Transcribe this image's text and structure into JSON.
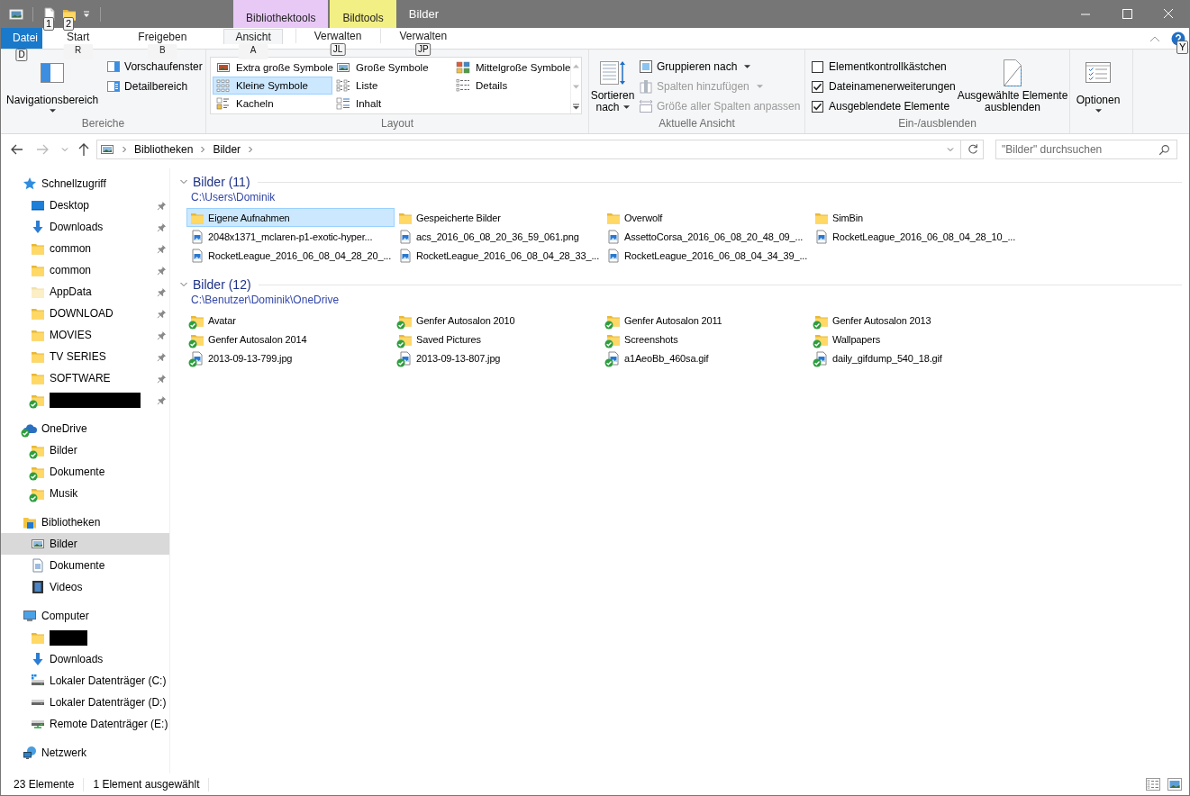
{
  "window": {
    "title": "Bilder",
    "quick_access_keytips": [
      "1",
      "2"
    ]
  },
  "context_tabs": [
    {
      "label": "Bibliothektools",
      "color": "#e8c9f6"
    },
    {
      "label": "Bildtools",
      "color": "#f2ef84"
    }
  ],
  "ribbon_tabs": [
    {
      "label": "Datei",
      "kind": "file",
      "keytip": "D",
      "selected": false
    },
    {
      "label": "Start",
      "kind": "tab",
      "keytip": "R",
      "selected": false
    },
    {
      "label": "Freigeben",
      "kind": "tab",
      "keytip": "B",
      "selected": false
    },
    {
      "label": "Ansicht",
      "kind": "tab",
      "keytip": "A",
      "selected": true
    },
    {
      "label": "Verwalten",
      "kind": "context",
      "keytip": "JL",
      "selected": false
    },
    {
      "label": "Verwalten",
      "kind": "context",
      "keytip": "JP",
      "selected": false
    }
  ],
  "help_keytip": "Y",
  "ribbon": {
    "panes": {
      "label": "Bereiche",
      "navigation_pane": "Navigationsbereich",
      "preview_pane": "Vorschaufenster",
      "details_pane": "Detailbereich"
    },
    "layout": {
      "label": "Layout",
      "options": [
        {
          "label": "Extra große Symbole",
          "kind": "xl",
          "selected": false
        },
        {
          "label": "Große Symbole",
          "kind": "large",
          "selected": false
        },
        {
          "label": "Mittelgroße Symbole",
          "kind": "medium",
          "selected": false
        },
        {
          "label": "Kleine Symbole",
          "kind": "small",
          "selected": true
        },
        {
          "label": "Liste",
          "kind": "list",
          "selected": false
        },
        {
          "label": "Details",
          "kind": "details",
          "selected": false
        },
        {
          "label": "Kacheln",
          "kind": "tiles",
          "selected": false
        },
        {
          "label": "Inhalt",
          "kind": "content",
          "selected": false
        }
      ]
    },
    "current_view": {
      "label": "Aktuelle Ansicht",
      "sort": "Sortieren nach",
      "commands": [
        {
          "label": "Gruppieren nach",
          "kind": "group",
          "dropdown": true,
          "disabled": false
        },
        {
          "label": "Spalten hinzufügen",
          "kind": "columns",
          "dropdown": true,
          "disabled": true
        },
        {
          "label": "Größe aller Spalten anpassen",
          "kind": "fit",
          "dropdown": false,
          "disabled": true
        }
      ]
    },
    "show_hide": {
      "label": "Ein-/ausblenden",
      "checkboxes": [
        {
          "label": "Elementkontrollkästchen",
          "checked": false
        },
        {
          "label": "Dateinamenerweiterungen",
          "checked": true
        },
        {
          "label": "Ausgeblendete Elemente",
          "checked": true
        }
      ],
      "hide_selected": "Ausgewählte Elemente ausblenden"
    },
    "options": {
      "label": "Optionen"
    }
  },
  "address": {
    "crumbs": [
      "Bibliotheken",
      "Bilder"
    ]
  },
  "search": {
    "placeholder": "\"Bilder\" durchsuchen"
  },
  "navigation": [
    {
      "label": "Schnellzugriff",
      "kind": "star",
      "synced": false,
      "children": [
        {
          "label": "Desktop",
          "kind": "desktop",
          "pinned": true,
          "synced": false,
          "selected": false
        },
        {
          "label": "Downloads",
          "kind": "download",
          "pinned": true,
          "synced": false,
          "selected": false
        },
        {
          "label": "common",
          "kind": "folder",
          "pinned": true,
          "synced": false,
          "selected": false
        },
        {
          "label": "common",
          "kind": "folder",
          "pinned": true,
          "synced": false,
          "selected": false
        },
        {
          "label": "AppData",
          "kind": "folder-hidden",
          "pinned": true,
          "synced": false,
          "selected": false
        },
        {
          "label": "DOWNLOAD",
          "kind": "folder",
          "pinned": true,
          "synced": false,
          "selected": false
        },
        {
          "label": "MOVIES",
          "kind": "folder",
          "pinned": true,
          "synced": false,
          "selected": false
        },
        {
          "label": "TV SERIES",
          "kind": "folder",
          "pinned": true,
          "synced": false,
          "selected": false
        },
        {
          "label": "SOFTWARE",
          "kind": "folder",
          "pinned": true,
          "synced": false,
          "selected": false
        },
        {
          "kind": "folder",
          "pinned": true,
          "synced": true,
          "selected": false
        }
      ]
    },
    {
      "label": "OneDrive",
      "kind": "cloud",
      "synced": true,
      "children": [
        {
          "label": "Bilder",
          "kind": "folder",
          "pinned": false,
          "synced": true,
          "selected": false
        },
        {
          "label": "Dokumente",
          "kind": "folder",
          "pinned": false,
          "synced": true,
          "selected": false
        },
        {
          "label": "Musik",
          "kind": "folder",
          "pinned": false,
          "synced": true,
          "selected": false
        }
      ]
    },
    {
      "label": "Bibliotheken",
      "kind": "library",
      "synced": false,
      "children": [
        {
          "label": "Bilder",
          "kind": "pictures",
          "pinned": false,
          "synced": false,
          "selected": true
        },
        {
          "label": "Dokumente",
          "kind": "documents",
          "pinned": false,
          "synced": false,
          "selected": false
        },
        {
          "label": "Videos",
          "kind": "videos",
          "pinned": false,
          "synced": false,
          "selected": false
        }
      ]
    },
    {
      "label": "Computer",
      "kind": "computer",
      "synced": false,
      "children": [
        {
          "kind": "folder",
          "pinned": false,
          "synced": false,
          "selected": false
        },
        {
          "label": "Downloads",
          "kind": "download",
          "pinned": false,
          "synced": false,
          "selected": false
        },
        {
          "label": "Lokaler Datenträger (C:)",
          "kind": "drive-system",
          "pinned": false,
          "synced": false,
          "selected": false
        },
        {
          "label": "Lokaler Datenträger (D:)",
          "kind": "drive",
          "pinned": false,
          "synced": false,
          "selected": false
        },
        {
          "label": "Remote Datenträger (E:)",
          "kind": "drive-network",
          "pinned": false,
          "synced": false,
          "selected": false
        }
      ]
    },
    {
      "label": "Netzwerk",
      "kind": "network",
      "synced": false
    }
  ],
  "content": {
    "groups": [
      {
        "title": "Bilder (11)",
        "path": "C:\\Users\\Dominik",
        "items": [
          {
            "name": "Eigene Aufnahmen",
            "kind": "folder",
            "synced": false,
            "selected": true
          },
          {
            "name": "Gespeicherte Bilder",
            "kind": "folder",
            "synced": false,
            "selected": false
          },
          {
            "name": "Overwolf",
            "kind": "folder",
            "synced": false,
            "selected": false
          },
          {
            "name": "SimBin",
            "kind": "folder",
            "synced": false,
            "selected": false
          },
          {
            "name": "2048x1371_mclaren-p1-exotic-hyper...",
            "kind": "image",
            "synced": false,
            "selected": false
          },
          {
            "name": "acs_2016_06_08_20_36_59_061.png",
            "kind": "image",
            "synced": false,
            "selected": false
          },
          {
            "name": "AssettoCorsa_2016_06_08_20_48_09_...",
            "kind": "image",
            "synced": false,
            "selected": false
          },
          {
            "name": "RocketLeague_2016_06_08_04_28_10_...",
            "kind": "image",
            "synced": false,
            "selected": false
          },
          {
            "name": "RocketLeague_2016_06_08_04_28_20_...",
            "kind": "image",
            "synced": false,
            "selected": false
          },
          {
            "name": "RocketLeague_2016_06_08_04_28_33_...",
            "kind": "image",
            "synced": false,
            "selected": false
          },
          {
            "name": "RocketLeague_2016_06_08_04_34_39_...",
            "kind": "image",
            "synced": false,
            "selected": false
          }
        ]
      },
      {
        "title": "Bilder (12)",
        "path": "C:\\Benutzer\\Dominik\\OneDrive",
        "items": [
          {
            "name": "Avatar",
            "kind": "folder",
            "synced": true,
            "selected": false
          },
          {
            "name": "Genfer Autosalon 2010",
            "kind": "folder",
            "synced": true,
            "selected": false
          },
          {
            "name": "Genfer Autosalon 2011",
            "kind": "folder",
            "synced": true,
            "selected": false
          },
          {
            "name": "Genfer Autosalon 2013",
            "kind": "folder",
            "synced": true,
            "selected": false
          },
          {
            "name": "Genfer Autosalon 2014",
            "kind": "folder",
            "synced": true,
            "selected": false
          },
          {
            "name": "Saved Pictures",
            "kind": "folder",
            "synced": true,
            "selected": false
          },
          {
            "name": "Screenshots",
            "kind": "folder",
            "synced": true,
            "selected": false
          },
          {
            "name": "Wallpapers",
            "kind": "folder",
            "synced": true,
            "selected": false
          },
          {
            "name": "2013-09-13-799.jpg",
            "kind": "image",
            "synced": true,
            "selected": false
          },
          {
            "name": "2013-09-13-807.jpg",
            "kind": "image",
            "synced": true,
            "selected": false
          },
          {
            "name": "a1AeoBb_460sa.gif",
            "kind": "image",
            "synced": true,
            "selected": false
          },
          {
            "name": "daily_gifdump_540_18.gif",
            "kind": "image",
            "synced": true,
            "selected": false
          }
        ]
      }
    ]
  },
  "status_bar": {
    "count": "23 Elemente",
    "selection": "1 Element ausgewählt"
  }
}
